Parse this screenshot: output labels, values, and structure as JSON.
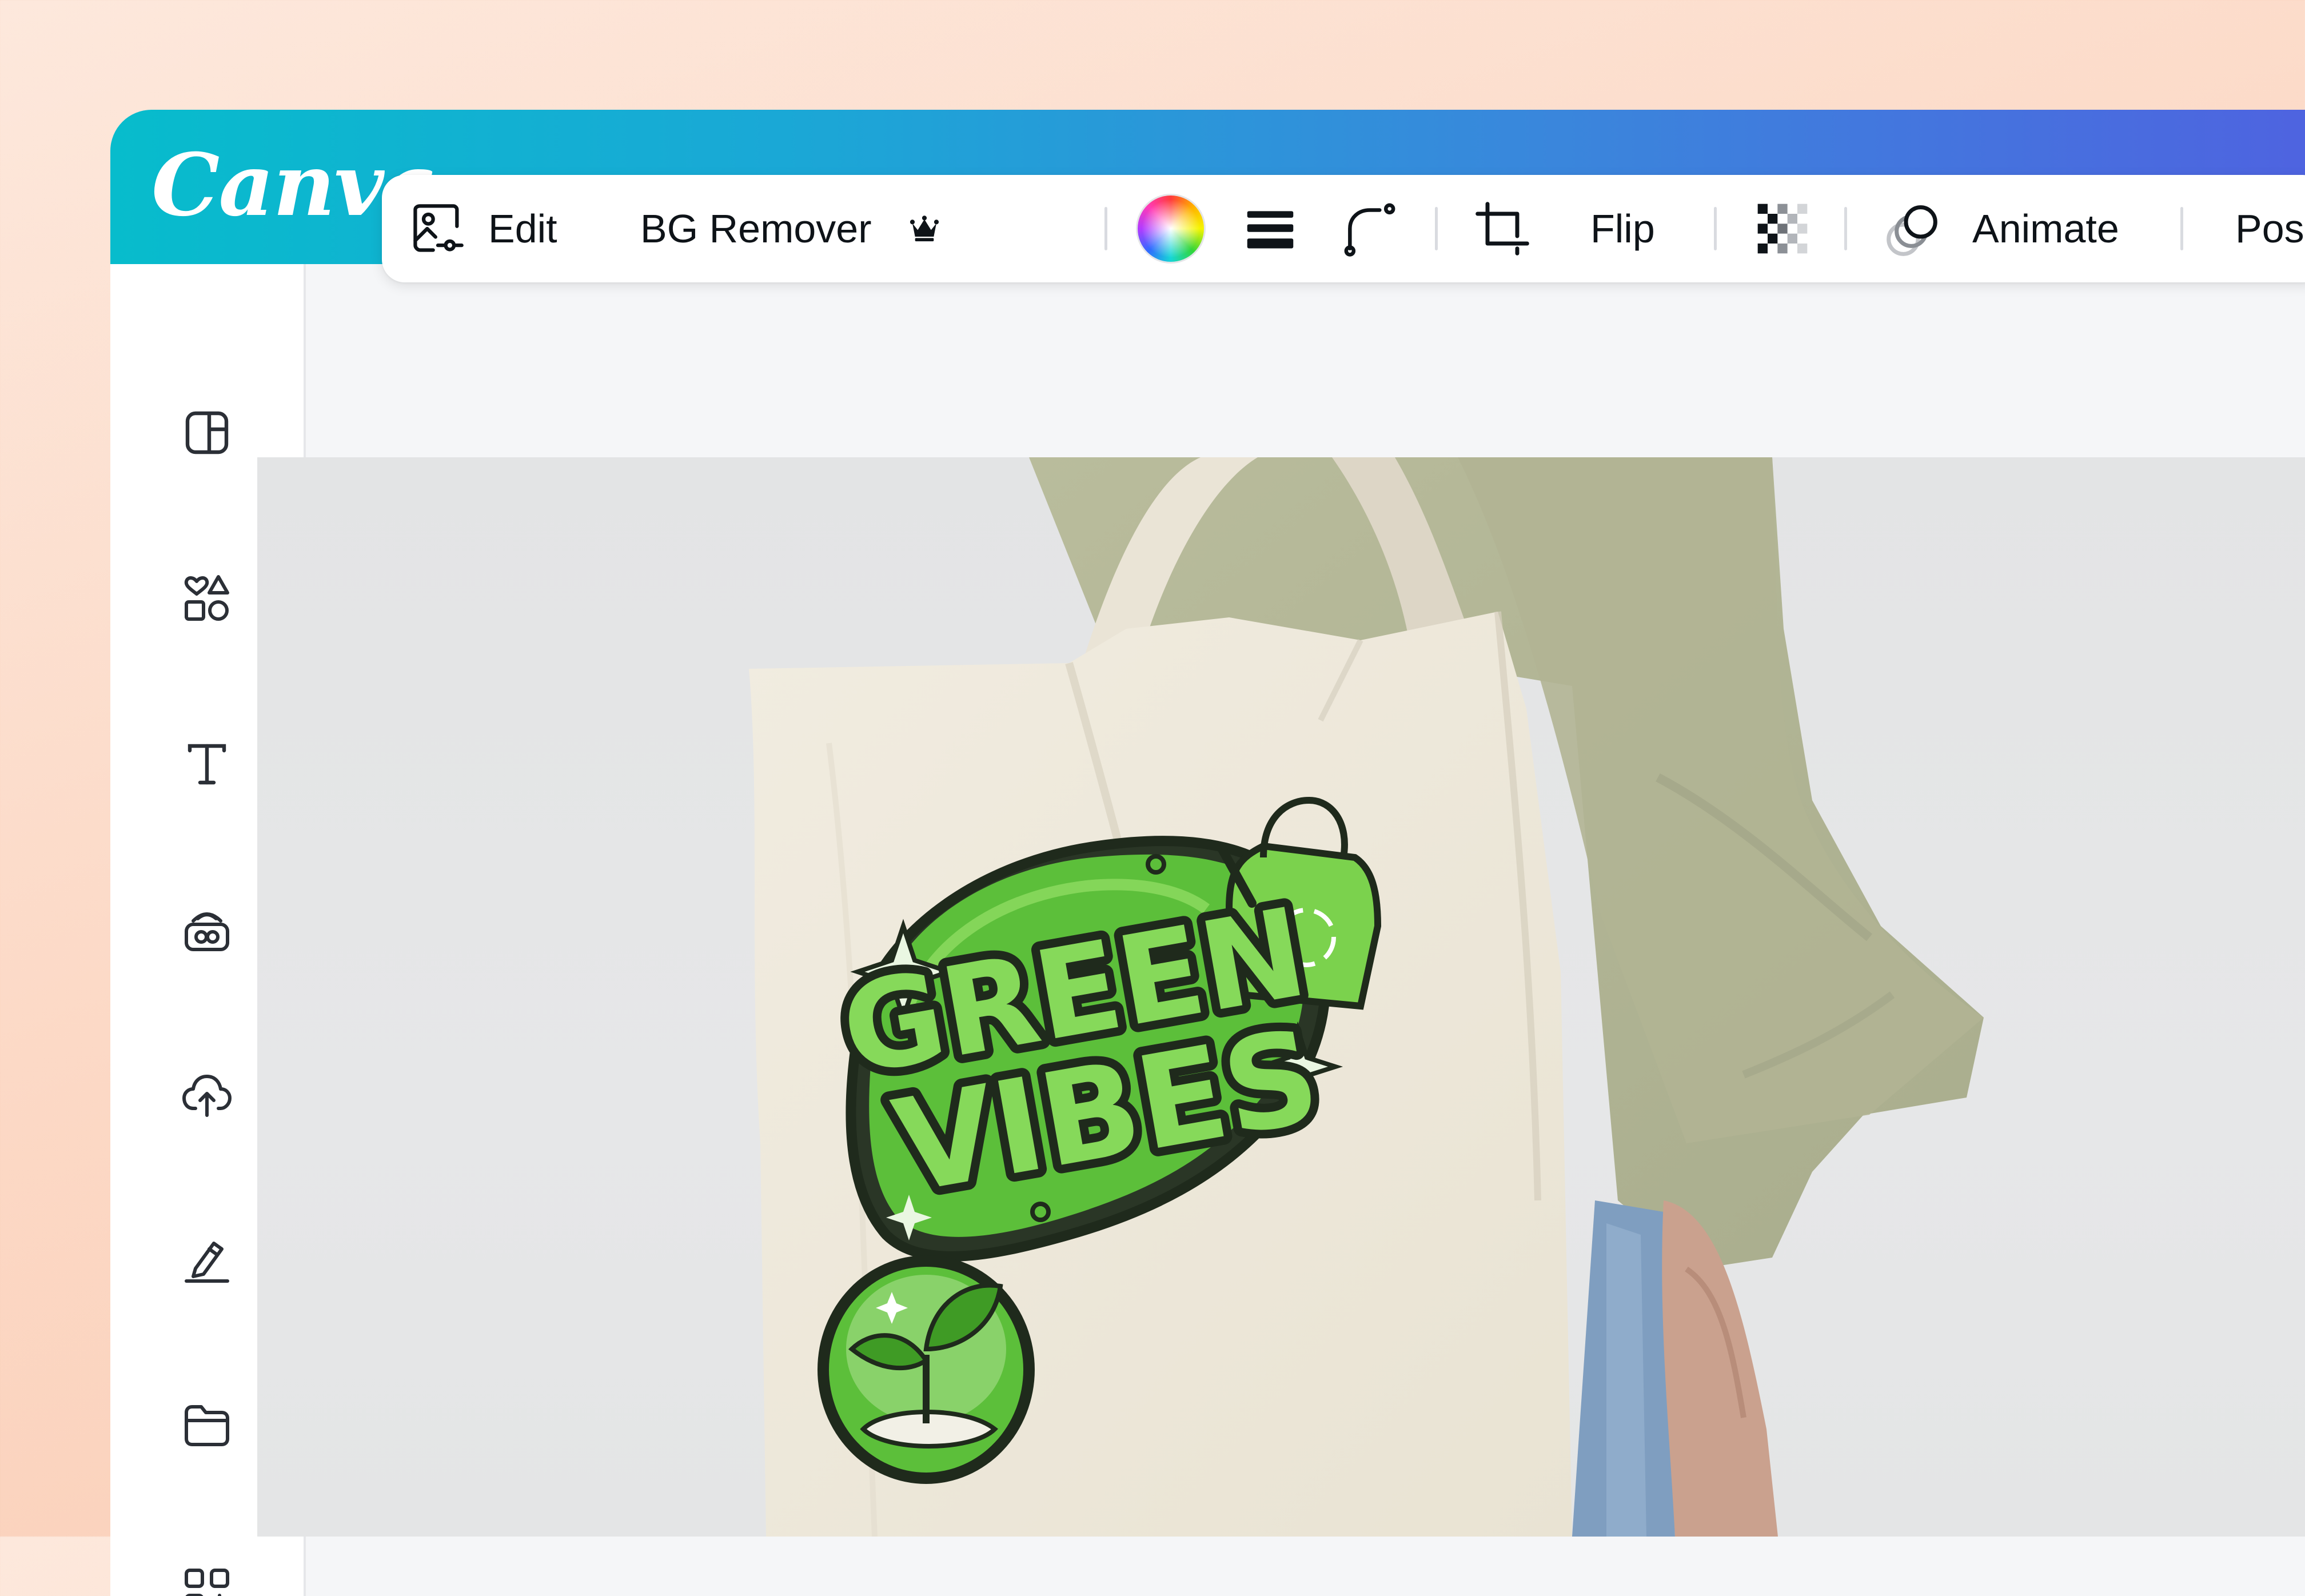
{
  "app": {
    "logo_text": "Canva"
  },
  "sidebar": {
    "items": [
      {
        "icon": "layout-icon"
      },
      {
        "icon": "elements-icon"
      },
      {
        "icon": "text-icon"
      },
      {
        "icon": "brand-icon"
      },
      {
        "icon": "uploads-icon"
      },
      {
        "icon": "draw-icon"
      },
      {
        "icon": "projects-icon"
      },
      {
        "icon": "apps-icon"
      }
    ]
  },
  "toolbar": {
    "edit_label": "Edit",
    "bg_remover_label": "BG Remover",
    "flip_label": "Flip",
    "animate_label": "Animate",
    "position_label": "Pos"
  },
  "design": {
    "sticker_line1": "GREEN",
    "sticker_line2": "VIBES"
  },
  "colors": {
    "topbar_start": "#07bccc",
    "topbar_end": "#4f62e0",
    "sticker_green": "#5cbf3a",
    "sticker_dark": "#1f2a1c"
  }
}
